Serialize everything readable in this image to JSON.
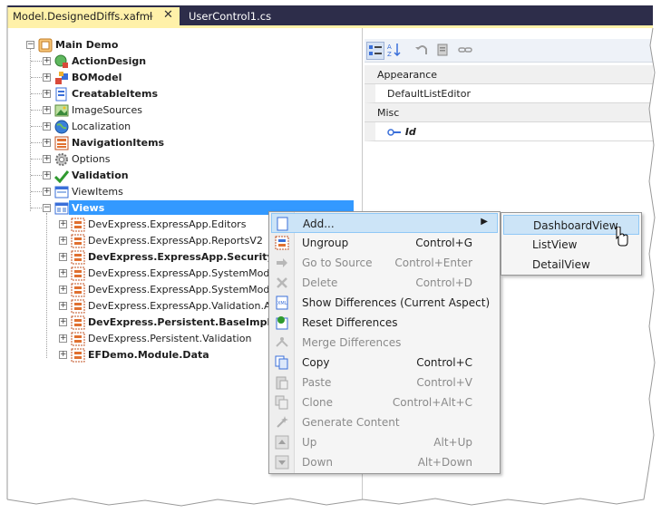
{
  "tabs": [
    {
      "label": "Model.DesignedDiffs.xafml",
      "active": true
    },
    {
      "label": "UserControl1.cs",
      "active": false
    }
  ],
  "tab_icons": {
    "pin": "pin-icon",
    "close": "close-icon"
  },
  "tree": {
    "root": "Main Demo",
    "children": [
      {
        "label": "ActionDesign",
        "bold": true,
        "icon": "action-icon"
      },
      {
        "label": "BOModel",
        "bold": true,
        "icon": "bomodel-icon"
      },
      {
        "label": "CreatableItems",
        "bold": true,
        "icon": "creatable-icon"
      },
      {
        "label": "ImageSources",
        "bold": false,
        "icon": "image-icon"
      },
      {
        "label": "Localization",
        "bold": false,
        "icon": "globe-icon"
      },
      {
        "label": "NavigationItems",
        "bold": true,
        "icon": "navigation-icon"
      },
      {
        "label": "Options",
        "bold": false,
        "icon": "gear-icon"
      },
      {
        "label": "Validation",
        "bold": true,
        "icon": "checkmark-icon"
      },
      {
        "label": "ViewItems",
        "bold": false,
        "icon": "viewitems-icon"
      },
      {
        "label": "Views",
        "bold": true,
        "selected": true,
        "icon": "views-icon"
      }
    ],
    "views_children": [
      {
        "label": "DevExpress.ExpressApp.Editors",
        "bold": false
      },
      {
        "label": "DevExpress.ExpressApp.ReportsV2",
        "bold": false
      },
      {
        "label": "DevExpress.ExpressApp.Security",
        "bold": true
      },
      {
        "label": "DevExpress.ExpressApp.SystemModule",
        "bold": false
      },
      {
        "label": "DevExpress.ExpressApp.SystemModule.N",
        "bold": false
      },
      {
        "label": "DevExpress.ExpressApp.Validation.AllCon",
        "bold": false
      },
      {
        "label": "DevExpress.Persistent.BaseImpl.EF",
        "bold": true
      },
      {
        "label": "DevExpress.Persistent.Validation",
        "bold": false
      },
      {
        "label": "EFDemo.Module.Data",
        "bold": true
      }
    ]
  },
  "properties": {
    "categories": [
      {
        "name": "Appearance",
        "items": [
          {
            "value": "DefaultListEditor"
          }
        ]
      },
      {
        "name": "Misc",
        "items": [
          {
            "value": "Id",
            "icon": "key-icon"
          }
        ]
      }
    ]
  },
  "context_menu": {
    "items": [
      {
        "label": "Add...",
        "shortcut": "",
        "enabled": true,
        "highlight": true,
        "submenu": true,
        "icon": "add-icon"
      },
      {
        "label": "Ungroup",
        "shortcut": "Control+G",
        "enabled": true,
        "icon": "ungroup-icon"
      },
      {
        "label": "Go to Source",
        "shortcut": "Control+Enter",
        "enabled": false,
        "icon": "go-to-source-icon"
      },
      {
        "label": "Delete",
        "shortcut": "Control+D",
        "enabled": false,
        "icon": "delete-icon"
      },
      {
        "label": "Show Differences (Current Aspect)",
        "shortcut": "",
        "enabled": true,
        "icon": "xml-diff-icon"
      },
      {
        "label": "Reset Differences",
        "shortcut": "",
        "enabled": true,
        "icon": "reset-diff-icon"
      },
      {
        "label": "Merge Differences",
        "shortcut": "",
        "enabled": false,
        "icon": "merge-icon"
      },
      {
        "label": "Copy",
        "shortcut": "Control+C",
        "enabled": true,
        "icon": "copy-icon"
      },
      {
        "label": "Paste",
        "shortcut": "Control+V",
        "enabled": false,
        "icon": "paste-icon"
      },
      {
        "label": "Clone",
        "shortcut": "Control+Alt+C",
        "enabled": false,
        "icon": "clone-icon"
      },
      {
        "label": "Generate Content",
        "shortcut": "",
        "enabled": false,
        "icon": "generate-icon"
      },
      {
        "label": "Up",
        "shortcut": "Alt+Up",
        "enabled": false,
        "icon": "up-icon"
      },
      {
        "label": "Down",
        "shortcut": "Alt+Down",
        "enabled": false,
        "icon": "down-icon"
      }
    ]
  },
  "submenu": {
    "items": [
      {
        "label": "DashboardView",
        "highlight": true
      },
      {
        "label": "ListView"
      },
      {
        "label": "DetailView"
      }
    ]
  },
  "colors": {
    "tab_active": "#fff1a9",
    "tab_strip": "#2d2d4a",
    "selection": "#3399ff",
    "menu_highlight": "#cce4f7"
  }
}
